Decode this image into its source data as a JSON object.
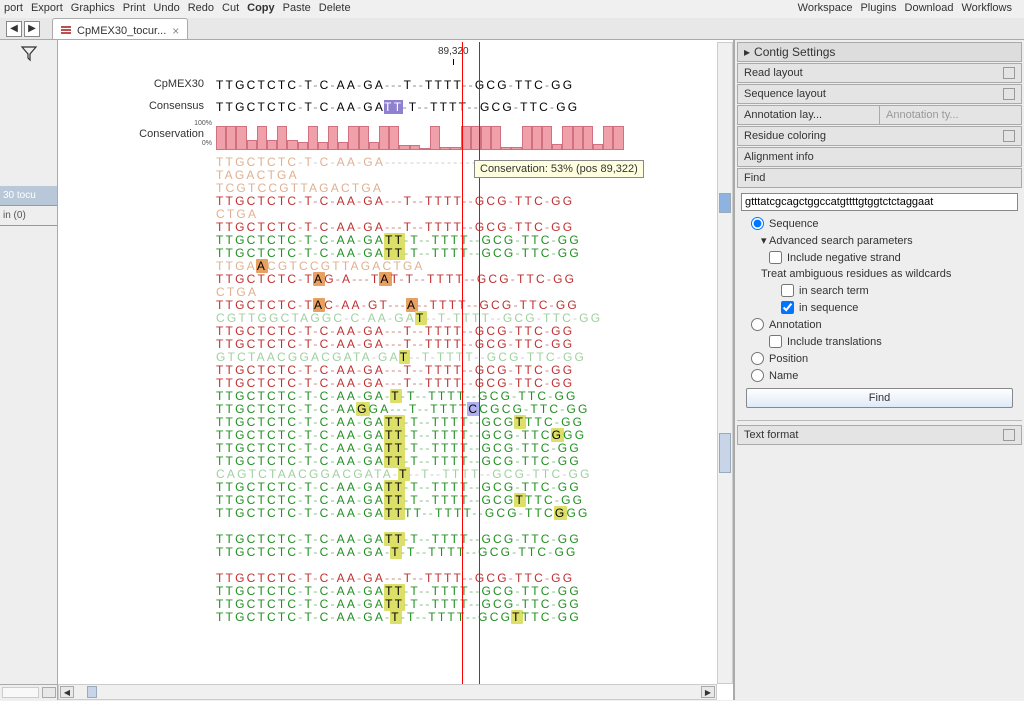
{
  "menu": {
    "left": [
      "port",
      "Export",
      "Graphics",
      "Print",
      "Undo",
      "Redo",
      "Cut",
      "Copy",
      "Paste",
      "Delete"
    ],
    "bold": {
      "7": true
    },
    "right": [
      "Workspace",
      "Plugins",
      "Download",
      "Workflows"
    ]
  },
  "tab": {
    "title": "CpMEX30_tocur...",
    "close": "×"
  },
  "ruler": {
    "pos_label": "89,320"
  },
  "ref": {
    "label": "CpMEX30",
    "seq": "TTGCTCTC-T-C-AA-GA---T--TTTT--GCG-TTC-GG"
  },
  "consensus": {
    "label": "Consensus",
    "seq": "TTGCTCTC-T-C-AA-GATT-T--TTTT--GCG-TTC-GG"
  },
  "conservation": {
    "label": "Conservation",
    "scale_top": "100%",
    "scale_bot": "0%",
    "bars": [
      92,
      92,
      92,
      40,
      92,
      40,
      92,
      40,
      30,
      92,
      30,
      92,
      30,
      92,
      92,
      30,
      92,
      92,
      18,
      18,
      6,
      92,
      10,
      10,
      92,
      92,
      92,
      92,
      10,
      10,
      92,
      92,
      92,
      25,
      92,
      92,
      92,
      25,
      92,
      92
    ]
  },
  "tooltip": "Conservation: 53% (pos 89,322)",
  "reads": [
    {
      "cls": "c-dim",
      "txt": "TTGCTCTC-T-C-AA-GA----------------------"
    },
    {
      "cls": "c-dim",
      "txt": "TAGACTGA"
    },
    {
      "cls": "c-dim",
      "txt": "TCGTCCGTTAGACTGA"
    },
    {
      "cls": "c-red",
      "txt": "TTGCTCTC-T-C-AA-GA---T--TTTT--GCG-TTC-GG"
    },
    {
      "cls": "c-dim",
      "txt": "CTGA"
    },
    {
      "cls": "c-red",
      "txt": "TTGCTCTC-T-C-AA-GA---T--TTTT--GCG-TTC-GG"
    },
    {
      "cls": "c-grn",
      "txt": "TTGCTCTC-T-C-AA-GATT-T--TTTT--GCG-TTC-GG",
      "hl": [
        {
          "i": 18,
          "c": "T",
          "t": "y"
        },
        {
          "i": 19,
          "c": "T",
          "t": "y"
        }
      ]
    },
    {
      "cls": "c-grn",
      "txt": "TTGCTCTC-T-C-AA-GATT-T--TTTT--GCG-TTC-GG",
      "hl": [
        {
          "i": 18,
          "c": "T",
          "t": "y"
        },
        {
          "i": 19,
          "c": "T",
          "t": "y"
        }
      ]
    },
    {
      "cls": "c-dim",
      "txt": "TTGATCGTCCGTTAGACTGA",
      "hl": [
        {
          "i": 4,
          "c": "A",
          "t": "o"
        }
      ]
    },
    {
      "cls": "c-red",
      "txt": "TTGCTCTC-TAG-A---TAT-T--TTTT--GCG-TTC-GG",
      "hl": [
        {
          "i": 10,
          "c": "A",
          "t": "o"
        },
        {
          "i": 18,
          "c": "A",
          "t": "o"
        }
      ]
    },
    {
      "cls": "c-dim",
      "txt": "CTGA"
    },
    {
      "cls": "c-red",
      "txt": "TTGCTCTC-TAC-AA-GT---A--TTTT--GCG-TTC-GG",
      "hl": [
        {
          "i": 10,
          "c": "A",
          "t": "o"
        },
        {
          "i": 21,
          "c": "A",
          "t": "o"
        }
      ]
    },
    {
      "cls": "c-dimg",
      "txt": "CGTTGGCTAGGC-C-AA-GAT--T-TTTT--GCG-TTC-GG",
      "hl": [
        {
          "i": 20,
          "c": "T",
          "t": "y"
        }
      ]
    },
    {
      "cls": "c-red",
      "txt": "TTGCTCTC-T-C-AA-GA---T--TTTT--GCG-TTC-GG"
    },
    {
      "cls": "c-red",
      "txt": "TTGCTCTC-T-C-AA-GA---T--TTTT--GCG-TTC-GG"
    },
    {
      "cls": "c-dimg",
      "txt": "GTCTAACGGACGATA-GAT--T-TTTT--GCG-TTC-GG",
      "hl": [
        {
          "i": 18,
          "c": "T",
          "t": "y"
        }
      ]
    },
    {
      "cls": "c-red",
      "txt": "TTGCTCTC-T-C-AA-GA---T--TTTT--GCG-TTC-GG"
    },
    {
      "cls": "c-red",
      "txt": "TTGCTCTC-T-C-AA-GA---T--TTTT--GCG-TTC-GG"
    },
    {
      "cls": "c-grn",
      "txt": "TTGCTCTC-T-C-AA-GA-T-T--TTTT--GCG-TTC-GG",
      "hl": [
        {
          "i": 19,
          "c": "T",
          "t": "y"
        }
      ]
    },
    {
      "cls": "c-grn",
      "txt": "TTGCTCTC-T-C-AAGGA---T--TTTTCCGCG-TTC-GG",
      "hl": [
        {
          "i": 15,
          "c": "G",
          "t": "y"
        },
        {
          "i": 28,
          "c": "C",
          "t": "b"
        }
      ]
    },
    {
      "cls": "c-grn",
      "txt": "TTGCTCTC-T-C-AA-GATT-T--TTTT--GCGTTTC-GG",
      "hl": [
        {
          "i": 18,
          "c": "T",
          "t": "y"
        },
        {
          "i": 19,
          "c": "T",
          "t": "y"
        },
        {
          "i": 33,
          "c": "T",
          "t": "y"
        }
      ]
    },
    {
      "cls": "c-grn",
      "txt": "TTGCTCTC-T-C-AA-GATT-T--TTTT--GCG-TTCGGG",
      "hl": [
        {
          "i": 18,
          "c": "T",
          "t": "y"
        },
        {
          "i": 19,
          "c": "T",
          "t": "y"
        },
        {
          "i": 37,
          "c": "G",
          "t": "y"
        }
      ]
    },
    {
      "cls": "c-grn",
      "txt": "TTGCTCTC-T-C-AA-GATT-T--TTTT--GCG-TTC-GG",
      "hl": [
        {
          "i": 18,
          "c": "T",
          "t": "y"
        },
        {
          "i": 19,
          "c": "T",
          "t": "y"
        }
      ]
    },
    {
      "cls": "c-grn",
      "txt": "TTGCTCTC-T-C-AA-GATT-T--TTTT--GCG-TTC-GG",
      "hl": [
        {
          "i": 18,
          "c": "T",
          "t": "y"
        },
        {
          "i": 19,
          "c": "T",
          "t": "y"
        }
      ]
    },
    {
      "cls": "c-dimg",
      "txt": "CAGTCTAACGGACGATA-T--T--TTTT--GCG-TTC-GG",
      "hl": [
        {
          "i": 18,
          "c": "T",
          "t": "y"
        }
      ]
    },
    {
      "cls": "c-grn",
      "txt": "TTGCTCTC-T-C-AA-GATT-T--TTTT--GCG-TTC-GG",
      "hl": [
        {
          "i": 18,
          "c": "T",
          "t": "y"
        },
        {
          "i": 19,
          "c": "T",
          "t": "y"
        }
      ]
    },
    {
      "cls": "c-grn",
      "txt": "TTGCTCTC-T-C-AA-GATT-T--TTTT--GCGTTTC-GG",
      "hl": [
        {
          "i": 18,
          "c": "T",
          "t": "y"
        },
        {
          "i": 19,
          "c": "T",
          "t": "y"
        },
        {
          "i": 33,
          "c": "T",
          "t": "y"
        }
      ]
    },
    {
      "cls": "c-grn",
      "txt": "TTGCTCTC-T-C-AA-GATTTT--TTTT--GCG-TTCGGG",
      "hl": [
        {
          "i": 18,
          "c": "T",
          "t": "y"
        },
        {
          "i": 19,
          "c": "T",
          "t": "y"
        },
        {
          "i": 37,
          "c": "G",
          "t": "y"
        }
      ]
    },
    {
      "cls": "c-blk",
      "txt": " "
    },
    {
      "cls": "c-grn",
      "txt": "TTGCTCTC-T-C-AA-GATT-T--TTTT--GCG-TTC-GG",
      "hl": [
        {
          "i": 18,
          "c": "T",
          "t": "y"
        },
        {
          "i": 19,
          "c": "T",
          "t": "y"
        }
      ]
    },
    {
      "cls": "c-grn",
      "txt": "TTGCTCTC-T-C-AA-GA-T-T--TTTT--GCG-TTC-GG",
      "hl": [
        {
          "i": 19,
          "c": "T",
          "t": "y"
        }
      ]
    },
    {
      "cls": "c-blk",
      "txt": " "
    },
    {
      "cls": "c-red",
      "txt": "TTGCTCTC-T-C-AA-GA---T--TTTT--GCG-TTC-GG"
    },
    {
      "cls": "c-grn",
      "txt": "TTGCTCTC-T-C-AA-GATT-T--TTTT--GCG-TTC-GG",
      "hl": [
        {
          "i": 18,
          "c": "T",
          "t": "y"
        },
        {
          "i": 19,
          "c": "T",
          "t": "y"
        }
      ]
    },
    {
      "cls": "c-grn",
      "txt": "TTGCTCTC-T-C-AA-GATT-T--TTTT--GCG-TTC-GG",
      "hl": [
        {
          "i": 18,
          "c": "T",
          "t": "y"
        },
        {
          "i": 19,
          "c": "T",
          "t": "y"
        }
      ]
    },
    {
      "cls": "c-grn",
      "txt": "TTGCTCTC-T-C-AA-GA-T-T--TTTT--GCGTTTC-GG",
      "hl": [
        {
          "i": 19,
          "c": "T",
          "t": "y"
        },
        {
          "i": 33,
          "c": "T",
          "t": "y"
        }
      ]
    }
  ],
  "side": {
    "item1": "30 tocu",
    "item2": "in (0)"
  },
  "panel": {
    "header": "Contig Settings",
    "sections": {
      "read_layout": "Read layout",
      "sequence_layout": "Sequence layout",
      "annotation_lay": "Annotation lay...",
      "annotation_ty": "Annotation ty...",
      "residue_coloring": "Residue coloring",
      "alignment_info": "Alignment info",
      "find": "Find",
      "text_format": "Text format"
    },
    "find": {
      "input_value": "gtttatcgcagctggccatgttttgtggtctctaggaat",
      "sequence": "Sequence",
      "advanced": "Advanced search parameters",
      "include_neg": "Include negative strand",
      "treat_amb": "Treat ambiguous residues as wildcards",
      "in_search": "in search term",
      "in_sequence": "in sequence",
      "annotation": "Annotation",
      "include_trans": "Include translations",
      "position": "Position",
      "name": "Name",
      "find_btn": "Find"
    }
  }
}
